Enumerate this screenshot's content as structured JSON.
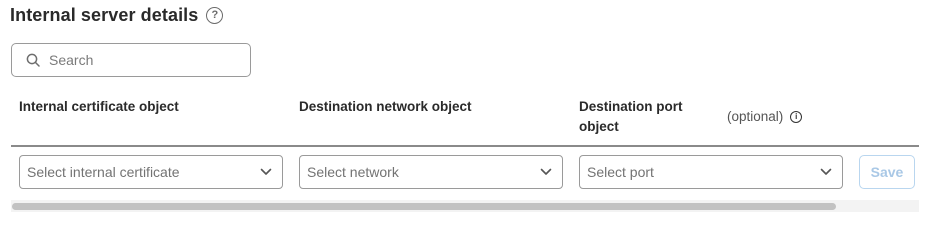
{
  "section": {
    "title": "Internal server details",
    "help_icon": "question-circle-icon",
    "help_glyph": "?"
  },
  "search": {
    "placeholder": "Search",
    "icon": "search-icon"
  },
  "columns": {
    "cert": "Internal certificate object",
    "network": "Destination network object",
    "port": "Destination port object",
    "optional": "(optional)",
    "info_icon": "info-icon",
    "info_glyph": "i"
  },
  "row": {
    "cert_placeholder": "Select internal certificate",
    "network_placeholder": "Select network",
    "port_placeholder": "Select port",
    "save_label": "Save"
  },
  "colors": {
    "save_disabled_text": "#a9c8e6",
    "save_disabled_border": "#b9d6ef",
    "border": "#9a9a9a"
  }
}
